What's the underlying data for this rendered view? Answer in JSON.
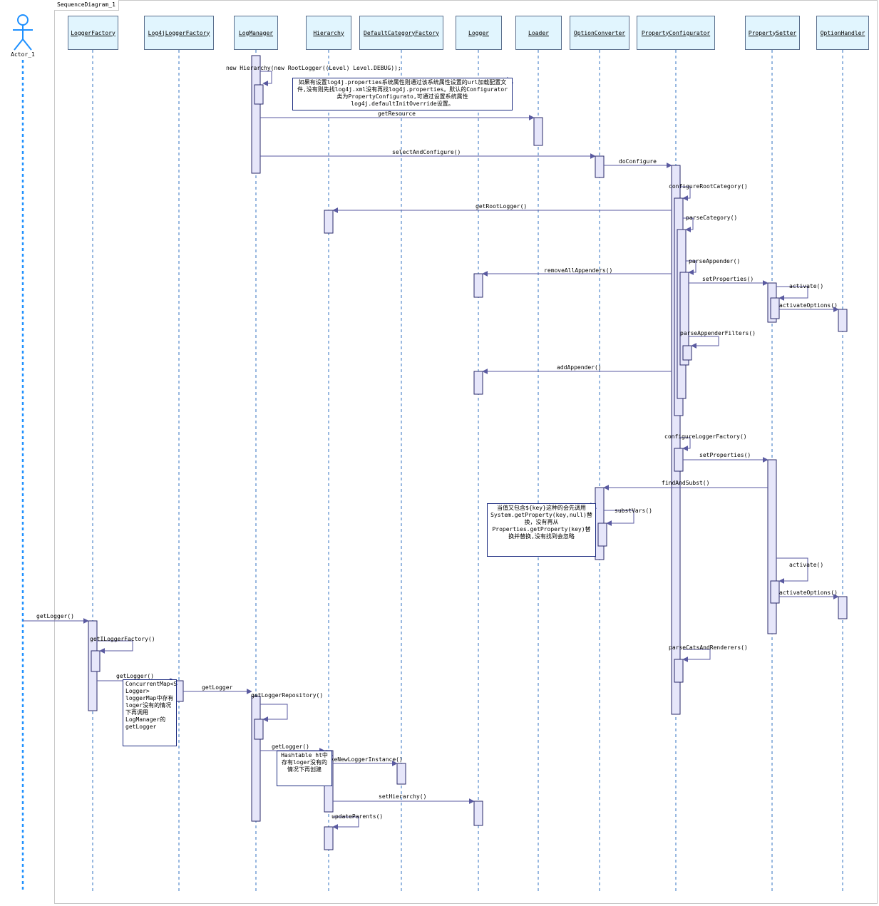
{
  "frame": {
    "title": "SequenceDiagram_1"
  },
  "actor": {
    "name": "Actor_1"
  },
  "lifelines": [
    "LoggerFactory",
    "Log4jLoggerFactory",
    "LogManager",
    "Hierarchy",
    "DefaultCategoryFactory",
    "Logger",
    "Loader",
    "OptionConverter",
    "PropertyConfigurator",
    "PropertySetter",
    "OptionHandler"
  ],
  "messages": [
    "new Hierarchy(new RootLogger((Level) Level.DEBUG));",
    "getResource",
    "selectAndConfigure()",
    "doConfigure",
    "configureRootCategory()",
    "getRootLogger()",
    "parseCategory()",
    "parseAppender()",
    "removeAllAppenders()",
    "setProperties()",
    "activate()",
    "activateOptions()",
    "parseAppenderFilters()",
    "addAppender()",
    "configureLoggerFactory()",
    "setProperties()",
    "findAndSubst()",
    "substVars()",
    "activate()",
    "activateOptions()",
    "parseCatsAndRenderers()",
    "getLogger()",
    "getILoggerFactory()",
    "getLogger()",
    "getLogger",
    "getLoggerRepository()",
    "getLogger()",
    "makeNewLoggerInstance()",
    "setHierarchy()",
    "updateParents()"
  ],
  "notes": [
    "如果有设置log4j.properties系统属性则通过该系统属性设置的url加载配置文件,没有则先找log4j.xml没有再找log4j.properties。默认的Configurator类为PropertyConfigurato,可通过设置系统属性log4j.defaultInitOverride设置。",
    "当值又包含${key}这种的会先调用System.getProperty(key,null)替换，没有再从Properties.getProperty(key)替换并替换,没有找到会忽略",
    "ConcurrentMap<String, Logger> loggerMap中存有loger没有的情况下再调用LogManager的getLogger",
    "Hashtable ht中存有loger没有的情况下再创建"
  ],
  "colors": {
    "lifeline_fill": "#e1f5fe",
    "activation_fill": "#e6e6fa",
    "line": "#5a6e8c",
    "arrow": "#5a5aa0",
    "actor": "#1e90ff"
  }
}
